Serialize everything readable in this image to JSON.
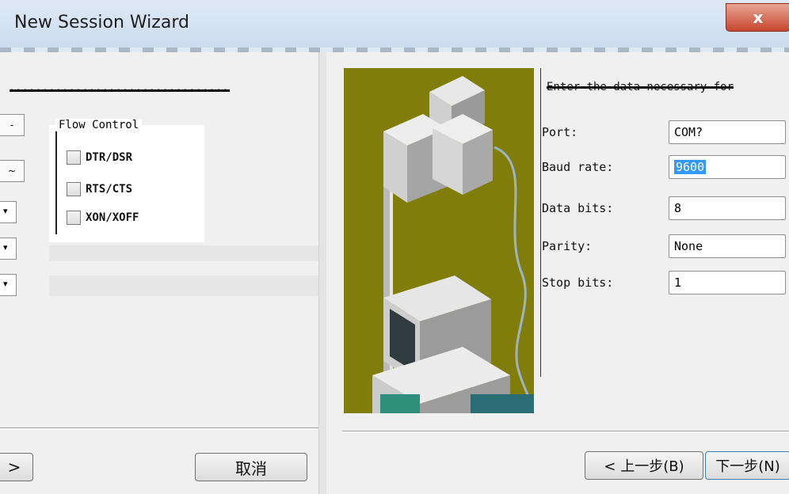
{
  "window": {
    "title": "New Session Wizard",
    "close_label": "x"
  },
  "left": {
    "heading": "~~~~~~~~~~~~~~~~~~~~~~~~~~~~~~~~~",
    "flow_control_title": "Flow Control",
    "checkboxes": [
      "DTR/DSR",
      "RTS/CTS",
      "XON/XOFF"
    ],
    "edge_glyphs": [
      "-",
      "~",
      "▾",
      "▾",
      "▾"
    ],
    "next_button_label": ">",
    "cancel_button_label": "取消"
  },
  "right": {
    "heading": "Enter the data necessary for",
    "port": {
      "label": "Port:",
      "value": "COM?"
    },
    "baud_rate": {
      "label": "Baud rate:",
      "value": "9600"
    },
    "data_bits": {
      "label": "Data bits:",
      "value": "8"
    },
    "parity": {
      "label": "Parity:",
      "value": "None"
    },
    "stop_bits": {
      "label": "Stop bits:",
      "value": "1"
    },
    "back_button_label": "< 上一步(B)",
    "next_button_label": "下一步(N)"
  },
  "colors": {
    "art_background": "#807d0a",
    "selection": "#3399ff",
    "close_red": "#c7462f"
  }
}
